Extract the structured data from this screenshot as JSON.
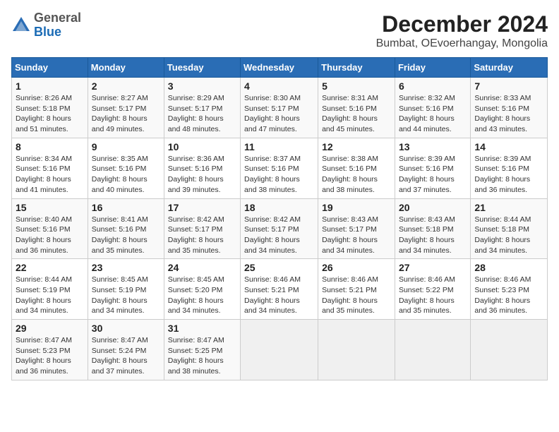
{
  "logo": {
    "general": "General",
    "blue": "Blue"
  },
  "title": "December 2024",
  "subtitle": "Bumbat, OEvoerhangay, Mongolia",
  "weekdays": [
    "Sunday",
    "Monday",
    "Tuesday",
    "Wednesday",
    "Thursday",
    "Friday",
    "Saturday"
  ],
  "weeks": [
    [
      {
        "day": "1",
        "sunrise": "8:26 AM",
        "sunset": "5:18 PM",
        "daylight": "8 hours and 51 minutes."
      },
      {
        "day": "2",
        "sunrise": "8:27 AM",
        "sunset": "5:17 PM",
        "daylight": "8 hours and 49 minutes."
      },
      {
        "day": "3",
        "sunrise": "8:29 AM",
        "sunset": "5:17 PM",
        "daylight": "8 hours and 48 minutes."
      },
      {
        "day": "4",
        "sunrise": "8:30 AM",
        "sunset": "5:17 PM",
        "daylight": "8 hours and 47 minutes."
      },
      {
        "day": "5",
        "sunrise": "8:31 AM",
        "sunset": "5:16 PM",
        "daylight": "8 hours and 45 minutes."
      },
      {
        "day": "6",
        "sunrise": "8:32 AM",
        "sunset": "5:16 PM",
        "daylight": "8 hours and 44 minutes."
      },
      {
        "day": "7",
        "sunrise": "8:33 AM",
        "sunset": "5:16 PM",
        "daylight": "8 hours and 43 minutes."
      }
    ],
    [
      {
        "day": "8",
        "sunrise": "8:34 AM",
        "sunset": "5:16 PM",
        "daylight": "8 hours and 41 minutes."
      },
      {
        "day": "9",
        "sunrise": "8:35 AM",
        "sunset": "5:16 PM",
        "daylight": "8 hours and 40 minutes."
      },
      {
        "day": "10",
        "sunrise": "8:36 AM",
        "sunset": "5:16 PM",
        "daylight": "8 hours and 39 minutes."
      },
      {
        "day": "11",
        "sunrise": "8:37 AM",
        "sunset": "5:16 PM",
        "daylight": "8 hours and 38 minutes."
      },
      {
        "day": "12",
        "sunrise": "8:38 AM",
        "sunset": "5:16 PM",
        "daylight": "8 hours and 38 minutes."
      },
      {
        "day": "13",
        "sunrise": "8:39 AM",
        "sunset": "5:16 PM",
        "daylight": "8 hours and 37 minutes."
      },
      {
        "day": "14",
        "sunrise": "8:39 AM",
        "sunset": "5:16 PM",
        "daylight": "8 hours and 36 minutes."
      }
    ],
    [
      {
        "day": "15",
        "sunrise": "8:40 AM",
        "sunset": "5:16 PM",
        "daylight": "8 hours and 36 minutes."
      },
      {
        "day": "16",
        "sunrise": "8:41 AM",
        "sunset": "5:16 PM",
        "daylight": "8 hours and 35 minutes."
      },
      {
        "day": "17",
        "sunrise": "8:42 AM",
        "sunset": "5:17 PM",
        "daylight": "8 hours and 35 minutes."
      },
      {
        "day": "18",
        "sunrise": "8:42 AM",
        "sunset": "5:17 PM",
        "daylight": "8 hours and 34 minutes."
      },
      {
        "day": "19",
        "sunrise": "8:43 AM",
        "sunset": "5:17 PM",
        "daylight": "8 hours and 34 minutes."
      },
      {
        "day": "20",
        "sunrise": "8:43 AM",
        "sunset": "5:18 PM",
        "daylight": "8 hours and 34 minutes."
      },
      {
        "day": "21",
        "sunrise": "8:44 AM",
        "sunset": "5:18 PM",
        "daylight": "8 hours and 34 minutes."
      }
    ],
    [
      {
        "day": "22",
        "sunrise": "8:44 AM",
        "sunset": "5:19 PM",
        "daylight": "8 hours and 34 minutes."
      },
      {
        "day": "23",
        "sunrise": "8:45 AM",
        "sunset": "5:19 PM",
        "daylight": "8 hours and 34 minutes."
      },
      {
        "day": "24",
        "sunrise": "8:45 AM",
        "sunset": "5:20 PM",
        "daylight": "8 hours and 34 minutes."
      },
      {
        "day": "25",
        "sunrise": "8:46 AM",
        "sunset": "5:21 PM",
        "daylight": "8 hours and 34 minutes."
      },
      {
        "day": "26",
        "sunrise": "8:46 AM",
        "sunset": "5:21 PM",
        "daylight": "8 hours and 35 minutes."
      },
      {
        "day": "27",
        "sunrise": "8:46 AM",
        "sunset": "5:22 PM",
        "daylight": "8 hours and 35 minutes."
      },
      {
        "day": "28",
        "sunrise": "8:46 AM",
        "sunset": "5:23 PM",
        "daylight": "8 hours and 36 minutes."
      }
    ],
    [
      {
        "day": "29",
        "sunrise": "8:47 AM",
        "sunset": "5:23 PM",
        "daylight": "8 hours and 36 minutes."
      },
      {
        "day": "30",
        "sunrise": "8:47 AM",
        "sunset": "5:24 PM",
        "daylight": "8 hours and 37 minutes."
      },
      {
        "day": "31",
        "sunrise": "8:47 AM",
        "sunset": "5:25 PM",
        "daylight": "8 hours and 38 minutes."
      },
      null,
      null,
      null,
      null
    ]
  ]
}
